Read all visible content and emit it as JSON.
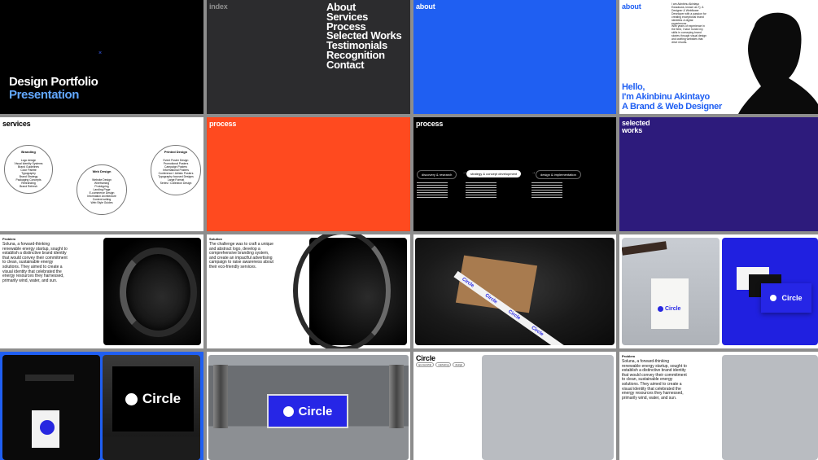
{
  "slide1": {
    "title_line1": "Design Portfolio",
    "title_line2": "Presentation",
    "marker": "×"
  },
  "slide2": {
    "label": "index",
    "items": [
      "About",
      "Services",
      "Process",
      "Selected Works",
      "Testimonials",
      "Recognition",
      "Contact"
    ]
  },
  "slide3": {
    "label": "about"
  },
  "slide4": {
    "label": "about",
    "bio": "I am Akinbinu Akintayo Ewaoluwa, known as Tj. A Designer & Webflower Developer with a passion for creating exceptional brand identities & digital experiences",
    "bio2": "With years of experience in the field, I have honed my skills in conveying brand stories through visual design and crafting websites that drive results.",
    "greeting_line1": "Hello,",
    "greeting_line2": "I'm Akinbinu Akintayo",
    "greeting_line3": "A Brand & Web Designer"
  },
  "slide5": {
    "label": "services",
    "branding": {
      "title": "Branding",
      "items": [
        "Logo design",
        "Visual Identity Systems",
        "Brand Guidelines",
        "Color Palette",
        "Typography",
        "Brand Strategy",
        "Packaging Concepts",
        "Rebranding",
        "Brand Refresh"
      ]
    },
    "web": {
      "title": "Web Design",
      "items": [
        "Website Design",
        "Wireframing",
        "Prototyping",
        "Landing Page",
        "E-commerce Design",
        "Information Architecture",
        "Content writing",
        "Web Style Guides"
      ]
    },
    "print": {
      "title": "Printed Design",
      "items": [
        "Event Poster Design",
        "Promotional Posters",
        "Campaign Posters",
        "Informational Posters",
        "Conference / Artistic Posters",
        "Typography focused Designs",
        "Large Format",
        "Series / Collection Design"
      ]
    }
  },
  "slide6": {
    "label": "process"
  },
  "slide7": {
    "label": "process",
    "steps": [
      "discovery & research",
      "strategy & concept development",
      "design & implementation"
    ],
    "arrow": "→"
  },
  "slide8": {
    "label_line1": "selected",
    "label_line2": "works"
  },
  "slide9": {
    "label": "Problem",
    "text": "Soluna, a forward-thinking renewable energy startup, sought to establish a distinctive brand identity that would convey their commitment to clean, sustainable energy solutions. They aimed to create a visual identity that celebrated the energy resources they harnessed, primarily wind, water, and sun."
  },
  "slide10": {
    "label": "Solution",
    "text": "The challenge was to craft a unique and abstract logo, develop a comprehensive branding system, and create an impactful advertising campaign to raise awareness about their eco-friendly services."
  },
  "slide11": {
    "tape": "Circle"
  },
  "slide12": {
    "card": "Circle",
    "bag": "Circle"
  },
  "slide13": {
    "billboard": "Circle"
  },
  "slide14": {
    "billboard": "Circle"
  },
  "slide15": {
    "title": "Circle",
    "tags": [
      "sponsorship",
      "marketing",
      "design"
    ]
  },
  "slide16": {
    "label": "Problem",
    "text": "Soluna, a forward-thinking renewable energy startup, sought to establish a distinctive brand identity that would convey their commitment to clean, sustainable energy solutions. They aimed to create a visual identity that celebrated the energy resources they harnessed, primarily wind, water, and sun."
  },
  "colors": {
    "blue": "#1f5ff2",
    "orange": "#ff4a1f",
    "purple": "#2d1b7c",
    "circle_blue": "#2626e6",
    "accent_light_blue": "#62a8ff"
  }
}
